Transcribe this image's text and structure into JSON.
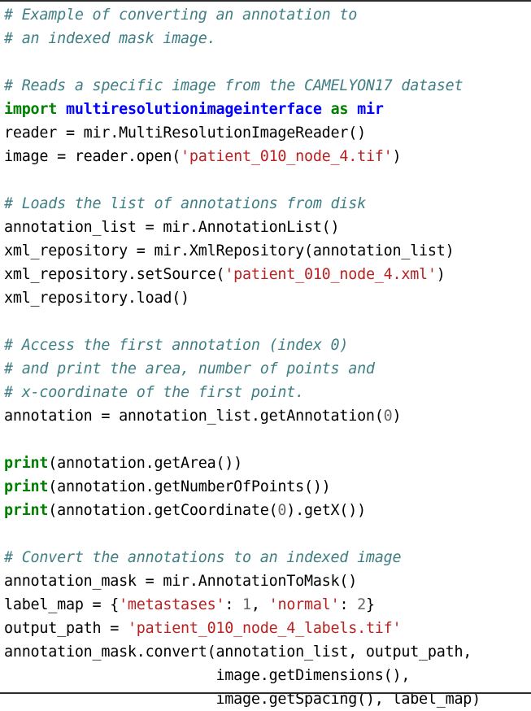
{
  "figure": {
    "kind": "python-code-listing",
    "language": "Python",
    "top_rule": true,
    "bottom_rule": true,
    "colors": {
      "background": "#ffffff",
      "text": "#000000",
      "comment": "#3f7f84",
      "keyword": "#008000",
      "builtin": "#008000",
      "namespace": "#0000ff",
      "string": "#ba2121",
      "number": "#666666",
      "rule": "#2b2b2b"
    }
  },
  "code": {
    "lines": [
      {
        "id": "line-1",
        "tokens": [
          {
            "t": "# Example of converting an annotation to",
            "c": "c"
          }
        ]
      },
      {
        "id": "line-2",
        "tokens": [
          {
            "t": "# an indexed mask image.",
            "c": "c"
          }
        ]
      },
      {
        "id": "line-3",
        "tokens": [
          {
            "t": "",
            "c": "n"
          }
        ]
      },
      {
        "id": "line-4",
        "tokens": [
          {
            "t": "# Reads a specific image from the CAMELYON17 dataset",
            "c": "c"
          }
        ]
      },
      {
        "id": "line-5",
        "tokens": [
          {
            "t": "import",
            "c": "k"
          },
          {
            "t": " ",
            "c": "n"
          },
          {
            "t": "multiresolutionimageinterface",
            "c": "nn"
          },
          {
            "t": " ",
            "c": "n"
          },
          {
            "t": "as",
            "c": "k"
          },
          {
            "t": " ",
            "c": "n"
          },
          {
            "t": "mir",
            "c": "nn"
          }
        ]
      },
      {
        "id": "line-6",
        "tokens": [
          {
            "t": "reader = mir.MultiResolutionImageReader()",
            "c": "n"
          }
        ]
      },
      {
        "id": "line-7",
        "tokens": [
          {
            "t": "image = reader.open(",
            "c": "n"
          },
          {
            "t": "'patient_010_node_4.tif'",
            "c": "s"
          },
          {
            "t": ")",
            "c": "n"
          }
        ]
      },
      {
        "id": "line-8",
        "tokens": [
          {
            "t": "",
            "c": "n"
          }
        ]
      },
      {
        "id": "line-9",
        "tokens": [
          {
            "t": "# Loads the list of annotations from disk",
            "c": "c"
          }
        ]
      },
      {
        "id": "line-10",
        "tokens": [
          {
            "t": "annotation_list = mir.AnnotationList()",
            "c": "n"
          }
        ]
      },
      {
        "id": "line-11",
        "tokens": [
          {
            "t": "xml_repository = mir.XmlRepository(annotation_list)",
            "c": "n"
          }
        ]
      },
      {
        "id": "line-12",
        "tokens": [
          {
            "t": "xml_repository.setSource(",
            "c": "n"
          },
          {
            "t": "'patient_010_node_4.xml'",
            "c": "s"
          },
          {
            "t": ")",
            "c": "n"
          }
        ]
      },
      {
        "id": "line-13",
        "tokens": [
          {
            "t": "xml_repository.load()",
            "c": "n"
          }
        ]
      },
      {
        "id": "line-14",
        "tokens": [
          {
            "t": "",
            "c": "n"
          }
        ]
      },
      {
        "id": "line-15",
        "tokens": [
          {
            "t": "# Access the first annotation (index 0)",
            "c": "c"
          }
        ]
      },
      {
        "id": "line-16",
        "tokens": [
          {
            "t": "# and print the area, number of points and",
            "c": "c"
          }
        ]
      },
      {
        "id": "line-17",
        "tokens": [
          {
            "t": "# x-coordinate of the first point.",
            "c": "c"
          }
        ]
      },
      {
        "id": "line-18",
        "tokens": [
          {
            "t": "annotation = annotation_list.getAnnotation(",
            "c": "n"
          },
          {
            "t": "0",
            "c": "mi"
          },
          {
            "t": ")",
            "c": "n"
          }
        ]
      },
      {
        "id": "line-19",
        "tokens": [
          {
            "t": "",
            "c": "n"
          }
        ]
      },
      {
        "id": "line-20",
        "tokens": [
          {
            "t": "print",
            "c": "nb"
          },
          {
            "t": "(annotation.getArea())",
            "c": "n"
          }
        ]
      },
      {
        "id": "line-21",
        "tokens": [
          {
            "t": "print",
            "c": "nb"
          },
          {
            "t": "(annotation.getNumberOfPoints())",
            "c": "n"
          }
        ]
      },
      {
        "id": "line-22",
        "tokens": [
          {
            "t": "print",
            "c": "nb"
          },
          {
            "t": "(annotation.getCoordinate(",
            "c": "n"
          },
          {
            "t": "0",
            "c": "mi"
          },
          {
            "t": ").getX())",
            "c": "n"
          }
        ]
      },
      {
        "id": "line-23",
        "tokens": [
          {
            "t": "",
            "c": "n"
          }
        ]
      },
      {
        "id": "line-24",
        "tokens": [
          {
            "t": "# Convert the annotations to an indexed image",
            "c": "c"
          }
        ]
      },
      {
        "id": "line-25",
        "tokens": [
          {
            "t": "annotation_mask = mir.AnnotationToMask()",
            "c": "n"
          }
        ]
      },
      {
        "id": "line-26",
        "tokens": [
          {
            "t": "label_map = {",
            "c": "n"
          },
          {
            "t": "'metastases'",
            "c": "s"
          },
          {
            "t": ": ",
            "c": "n"
          },
          {
            "t": "1",
            "c": "mi"
          },
          {
            "t": ", ",
            "c": "n"
          },
          {
            "t": "'normal'",
            "c": "s"
          },
          {
            "t": ": ",
            "c": "n"
          },
          {
            "t": "2",
            "c": "mi"
          },
          {
            "t": "}",
            "c": "n"
          }
        ]
      },
      {
        "id": "line-27",
        "tokens": [
          {
            "t": "output_path = ",
            "c": "n"
          },
          {
            "t": "'patient_010_node_4_labels.tif'",
            "c": "s"
          }
        ]
      },
      {
        "id": "line-28",
        "tokens": [
          {
            "t": "annotation_mask.convert(annotation_list, output_path,",
            "c": "n"
          }
        ]
      },
      {
        "id": "line-29",
        "tokens": [
          {
            "t": "                        image.getDimensions(),",
            "c": "n"
          }
        ]
      },
      {
        "id": "line-30",
        "tokens": [
          {
            "t": "                        image.getSpacing(), label_map)",
            "c": "n"
          }
        ]
      }
    ]
  }
}
